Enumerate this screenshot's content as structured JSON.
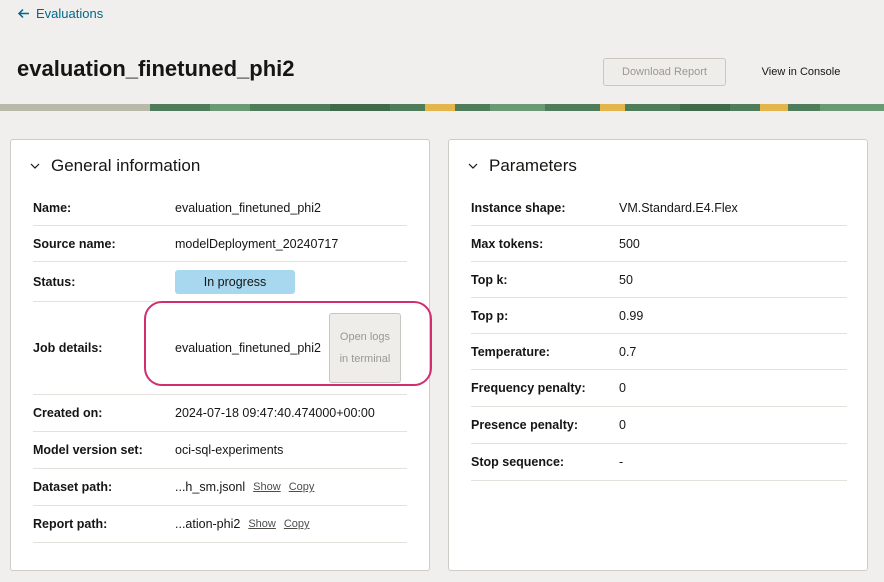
{
  "nav": {
    "back_label": "Evaluations"
  },
  "header": {
    "title": "evaluation_finetuned_phi2",
    "download_button": "Download Report",
    "console_button": "View in Console"
  },
  "general": {
    "title": "General information",
    "rows": [
      {
        "label": "Name:",
        "value": "evaluation_finetuned_phi2"
      },
      {
        "label": "Source name:",
        "value": "modelDeployment_20240717"
      },
      {
        "label": "Status:",
        "value": "In progress"
      },
      {
        "label": "Job details:",
        "value": "evaluation_finetuned_phi2",
        "button": "Open logs in terminal"
      },
      {
        "label": "Created on:",
        "value": "2024-07-18 09:47:40.474000+00:00"
      },
      {
        "label": "Model version set:",
        "value": "oci-sql-experiments"
      },
      {
        "label": "Dataset path:",
        "value": "...h_sm.jsonl",
        "show": "Show",
        "copy": "Copy"
      },
      {
        "label": "Report path:",
        "value": "...ation-phi2",
        "show": "Show",
        "copy": "Copy"
      }
    ]
  },
  "parameters": {
    "title": "Parameters",
    "rows": [
      {
        "label": "Instance shape:",
        "value": "VM.Standard.E4.Flex"
      },
      {
        "label": "Max tokens:",
        "value": "500"
      },
      {
        "label": "Top k:",
        "value": "50"
      },
      {
        "label": "Top p:",
        "value": "0.99"
      },
      {
        "label": "Temperature:",
        "value": "0.7"
      },
      {
        "label": "Frequency penalty:",
        "value": "0"
      },
      {
        "label": "Presence penalty:",
        "value": "0"
      },
      {
        "label": "Stop sequence:",
        "value": "-"
      }
    ]
  },
  "colors": {
    "link": "#00688c",
    "status_badge": "#a7d8f0",
    "highlight": "#d22d6e"
  }
}
